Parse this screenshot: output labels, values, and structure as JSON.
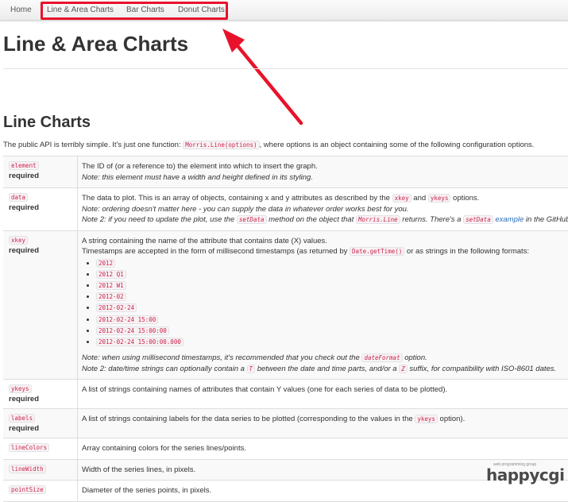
{
  "nav": {
    "home": "Home",
    "line_area": "Line & Area Charts",
    "bar": "Bar Charts",
    "donut": "Donut Charts"
  },
  "annotation": {
    "highlight_color": "#e8132b"
  },
  "page_title": "Line & Area Charts",
  "section_title": "Line Charts",
  "intro": {
    "before": "The public API is terribly simple. It's just one function: ",
    "code": "Morris.Line(options)",
    "after": ", where options is an object containing some of the following configuration options."
  },
  "options": {
    "required_label": "required",
    "element": {
      "name": "element",
      "desc": "The ID of (or a reference to) the element into which to insert the graph.",
      "note": "Note: this element must have a width and height defined in its styling."
    },
    "data": {
      "name": "data",
      "desc1": "The data to plot. This is an array of objects, containing x and y attributes as described by the ",
      "code_xkey": "xkey",
      "and": " and ",
      "code_ykeys": "ykeys",
      "desc2": " options.",
      "note1": "Note: ordering doesn't matter here - you can supply the data in whatever order works best for you.",
      "note2a": "Note 2: if you need to update the plot, use the ",
      "code_setdata": "setData",
      "note2b": " method on the object that ",
      "code_morrisline": "Morris.Line",
      "note2c": " returns. There's a ",
      "code_setdata2": "setData",
      "link_example": "example",
      "note2d": " in the GitHub repo."
    },
    "xkey": {
      "name": "xkey",
      "desc1": "A string containing the name of the attribute that contains date (X) values.",
      "desc2a": "Timestamps are accepted in the form of millisecond timestamps (as returned by ",
      "code_gettime": "Date.getTime()",
      "desc2b": " or as strings in the following formats:",
      "formats": [
        "2012",
        "2012 Q1",
        "2012 W1",
        "2012-02",
        "2012-02-24",
        "2012-02-24 15:00",
        "2012-02-24 15:00:00",
        "2012-02-24 15:00:00.000"
      ],
      "note1a": "Note: when using millisecond timestamps, it's recommended that you check out the ",
      "code_dateformat": "dateFormat",
      "note1b": " option.",
      "note2a": "Note 2: date/time strings can optionally contain a ",
      "code_t": "T",
      "note2b": " between the date and time parts, and/or a ",
      "code_z": "Z",
      "note2c": " suffix, for compatibility with ISO-8601 dates."
    },
    "ykeys": {
      "name": "ykeys",
      "desc": "A list of strings containing names of attributes that contain Y values (one for each series of data to be plotted)."
    },
    "labels": {
      "name": "labels",
      "desc1": "A list of strings containing labels for the data series to be plotted (corresponding to the values in the ",
      "code_ykeys": "ykeys",
      "desc2": " option)."
    },
    "lineColors": {
      "name": "lineColors",
      "desc": "Array containing colors for the series lines/points."
    },
    "lineWidth": {
      "name": "lineWidth",
      "desc": "Width of the series lines, in pixels."
    },
    "pointSize": {
      "name": "pointSize",
      "desc": "Diameter of the series points, in pixels."
    }
  },
  "watermark": {
    "tagline": "web programming group",
    "brand": "happycgi"
  }
}
